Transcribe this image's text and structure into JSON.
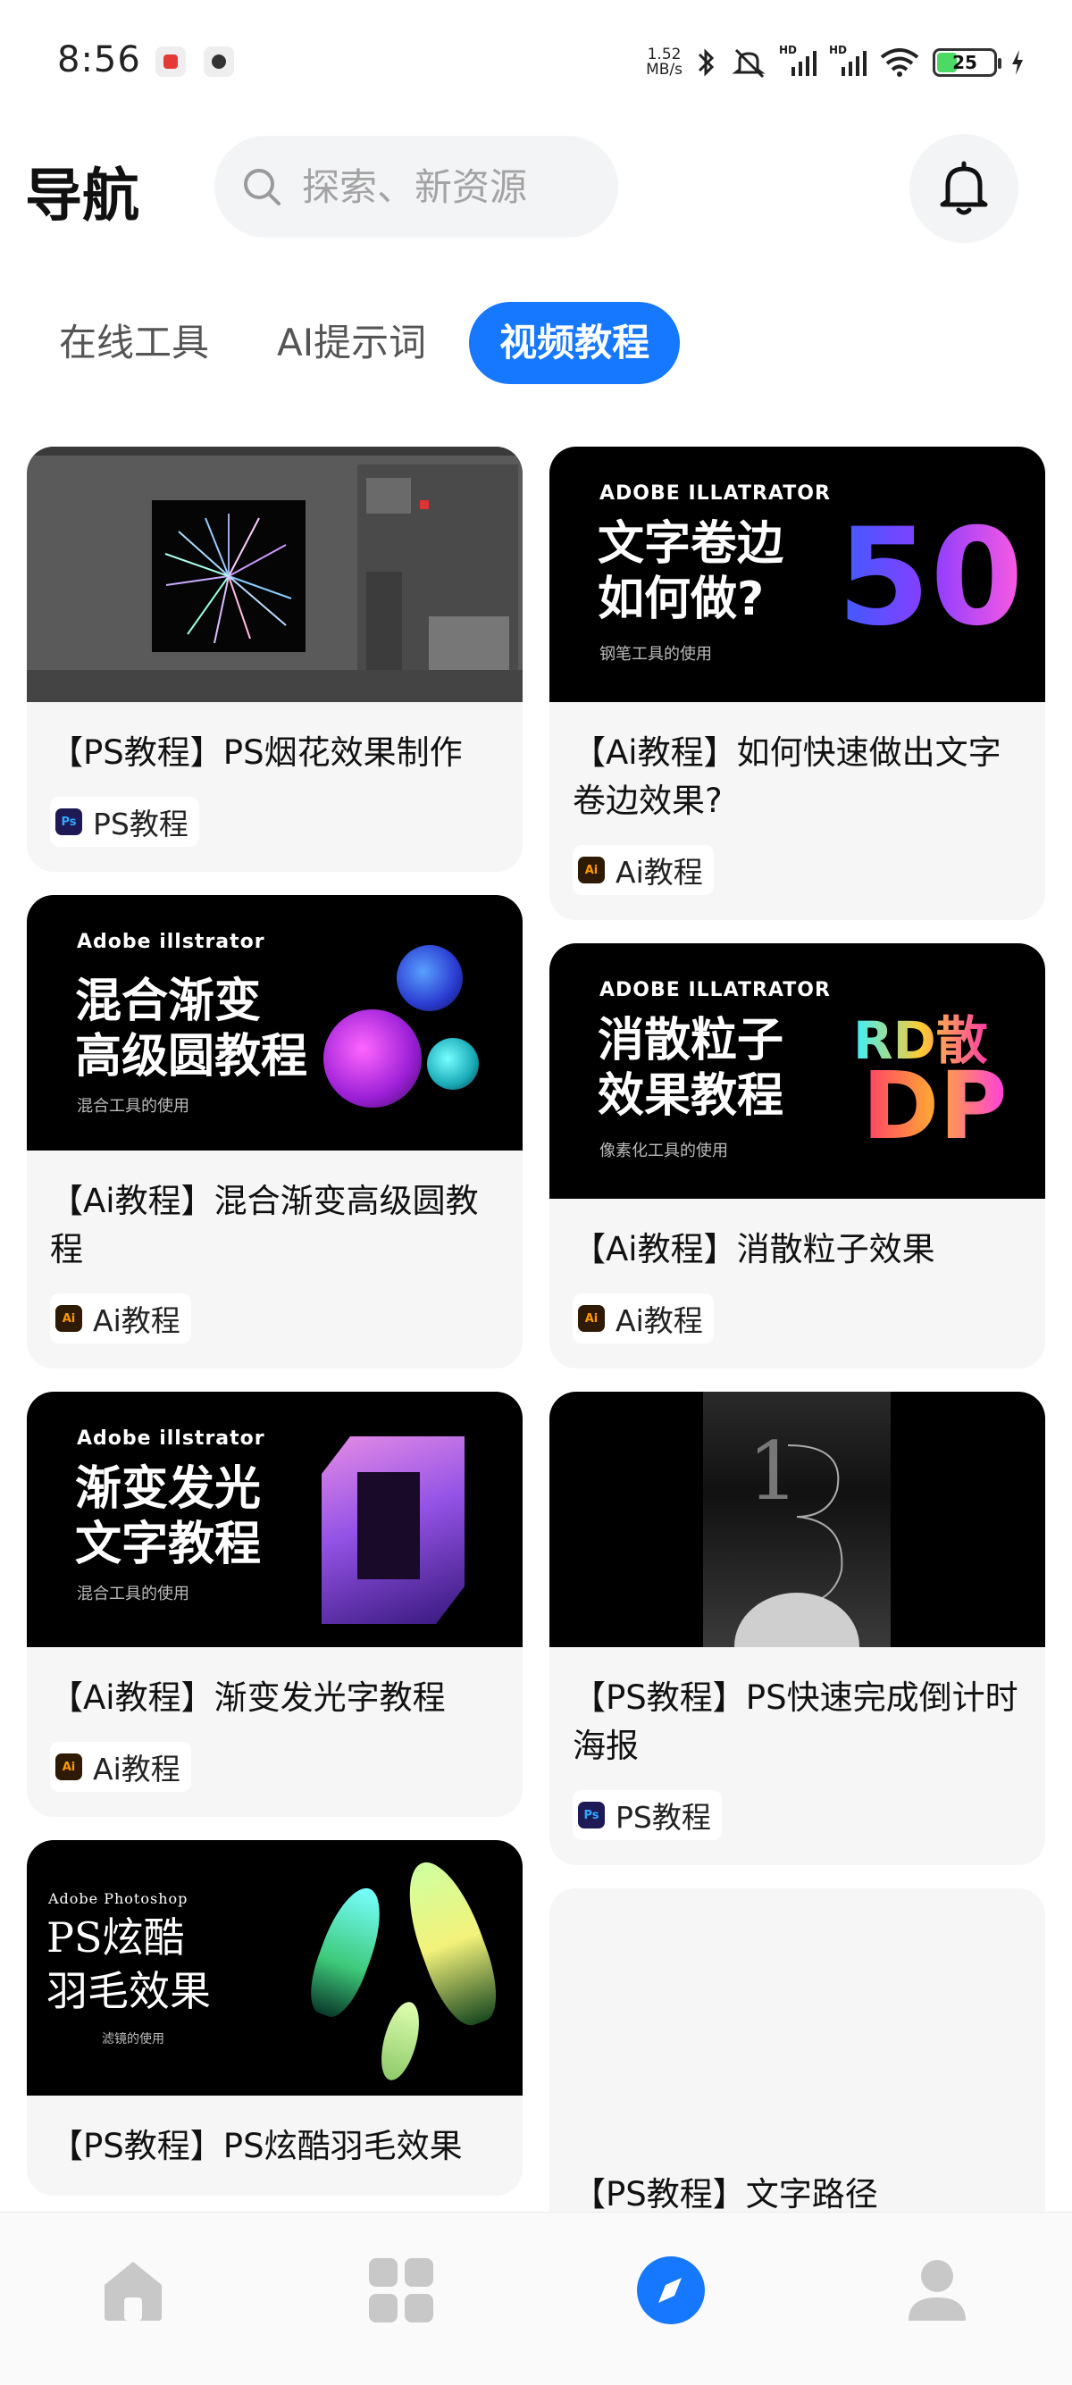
{
  "status_bar": {
    "time": "8:56",
    "net_speed_value": "1.52",
    "net_speed_unit": "MB/s",
    "signal_label_1": "HD",
    "signal_label_2": "HD",
    "battery": "25",
    "colors": {
      "app1": "#e53935",
      "app2": "#333333"
    }
  },
  "header": {
    "title": "导航",
    "search_placeholder": "探索、新资源",
    "bell_icon": "bell-icon"
  },
  "tabs": [
    {
      "label": "在线工具",
      "active": false
    },
    {
      "label": "AI提示词",
      "active": false
    },
    {
      "label": "视频教程",
      "active": true
    }
  ],
  "accent_color": "#1677ff",
  "cards_left": [
    {
      "title": "【PS教程】PS烟花效果制作",
      "tag": "PS教程",
      "tag_type": "ps",
      "thumb": "ps-screenshot"
    },
    {
      "title": "【Ai教程】混合渐变高级圆教程",
      "tag": "Ai教程",
      "tag_type": "ai",
      "thumb": "blend-circles",
      "thumb_brand": "Adobe illstrator",
      "thumb_title_1": "混合渐变",
      "thumb_title_2": "高级圆教程",
      "thumb_sub": "混合工具的使用"
    },
    {
      "title": "【Ai教程】渐变发光字教程",
      "tag": "Ai教程",
      "tag_type": "ai",
      "thumb": "glow-text",
      "thumb_brand": "Adobe illstrator",
      "thumb_title_1": "渐变发光",
      "thumb_title_2": "文字教程",
      "thumb_sub": "混合工具的使用"
    },
    {
      "title": "【PS教程】PS炫酷羽毛效果",
      "tag": "",
      "tag_type": "ps",
      "thumb": "feathers",
      "thumb_brand": "Adobe Photoshop",
      "thumb_title_1": "PS炫酷",
      "thumb_title_2": "羽毛效果",
      "thumb_sub": "滤镜的使用"
    }
  ],
  "cards_right": [
    {
      "title": "【Ai教程】如何快速做出文字卷边效果?",
      "tag": "Ai教程",
      "tag_type": "ai",
      "thumb": "curl-text",
      "thumb_brand": "ADOBE ILLATRATOR",
      "thumb_title_1": "文字卷边",
      "thumb_title_2": "如何做?",
      "thumb_sub": "钢笔工具的使用",
      "thumb_num": "50"
    },
    {
      "title": "【Ai教程】消散粒子效果",
      "tag": "Ai教程",
      "tag_type": "ai",
      "thumb": "particles",
      "thumb_brand": "ADOBE ILLATRATOR",
      "thumb_title_1": "消散粒子",
      "thumb_title_2": "效果教程",
      "thumb_sub": "像素化工具的使用",
      "thumb_art_1": "RD散",
      "thumb_art_2": "DP"
    },
    {
      "title": "【PS教程】PS快速完成倒计时海报",
      "tag": "PS教程",
      "tag_type": "ps",
      "thumb": "countdown-poster"
    },
    {
      "title": "【PS教程】文字路径",
      "tag": "",
      "tag_type": "ps",
      "thumb": "blank"
    }
  ],
  "bottom_nav": [
    {
      "icon": "home-icon",
      "active": false
    },
    {
      "icon": "grid-icon",
      "active": false
    },
    {
      "icon": "compass-icon",
      "active": true
    },
    {
      "icon": "profile-icon",
      "active": false
    }
  ]
}
